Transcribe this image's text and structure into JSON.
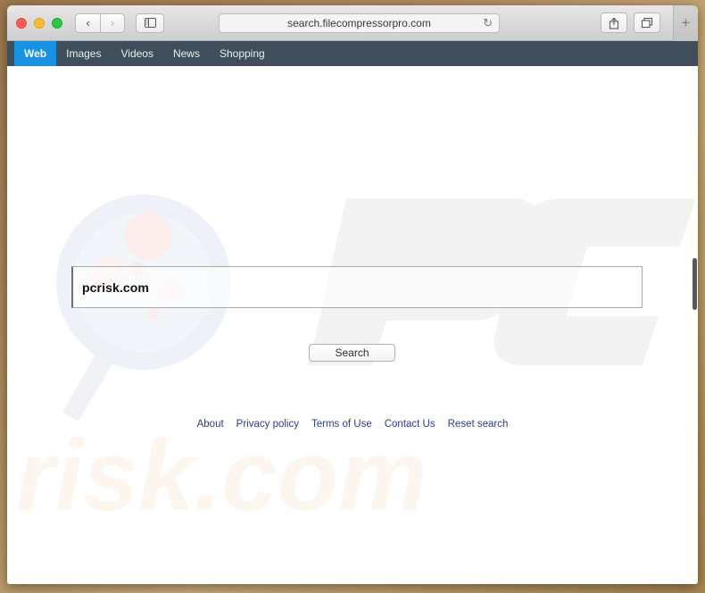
{
  "browser": {
    "window_controls": [
      {
        "name": "close",
        "color": "#ff5f57"
      },
      {
        "name": "minimize",
        "color": "#febc2e"
      },
      {
        "name": "zoom",
        "color": "#28c840"
      }
    ],
    "back_glyph": "‹",
    "forward_glyph": "›",
    "sidebar_glyph": "⌸",
    "url": "search.filecompressorpro.com",
    "reload_glyph": "↻",
    "share_glyph": "⇧",
    "tabs_glyph": "❐",
    "new_tab_glyph": "+"
  },
  "site_nav": {
    "tabs": [
      {
        "label": "Web",
        "active": true
      },
      {
        "label": "Images",
        "active": false
      },
      {
        "label": "Videos",
        "active": false
      },
      {
        "label": "News",
        "active": false
      },
      {
        "label": "Shopping",
        "active": false
      }
    ],
    "background_color": "#404e5c",
    "active_color": "#1791e2"
  },
  "search": {
    "value": "pcrisk.com",
    "placeholder": "",
    "button_label": "Search"
  },
  "footer": {
    "links": [
      {
        "label": "About"
      },
      {
        "label": "Privacy policy"
      },
      {
        "label": "Terms of Use"
      },
      {
        "label": "Contact Us"
      },
      {
        "label": "Reset search"
      }
    ],
    "link_color": "#2b3d8f"
  },
  "watermark": {
    "brand_top": "PC",
    "brand_bottom": "risk.com",
    "magnifier_color": "#eef1f6",
    "pc_color": "#f3f3f3",
    "risk_color": "#fdf6ef"
  },
  "desktop": {
    "background_color": "#b08f5f"
  }
}
